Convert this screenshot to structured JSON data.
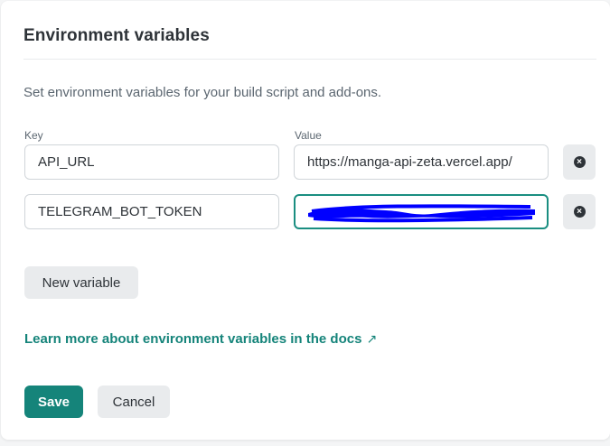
{
  "panel": {
    "title": "Environment variables",
    "description": "Set environment variables for your build script and add-ons."
  },
  "columns": {
    "key_label": "Key",
    "value_label": "Value"
  },
  "variables": [
    {
      "key": "API_URL",
      "value": "https://manga-api-zeta.vercel.app/"
    },
    {
      "key": "TELEGRAM_BOT_TOKEN",
      "value": ""
    }
  ],
  "actions": {
    "new_variable_label": "New variable",
    "docs_link_label": "Learn more about environment variables in the docs",
    "docs_link_icon": "↗",
    "save_label": "Save",
    "cancel_label": "Cancel",
    "remove_icon": "×"
  },
  "colors": {
    "accent": "#15847a",
    "redaction": "#0000ff"
  }
}
